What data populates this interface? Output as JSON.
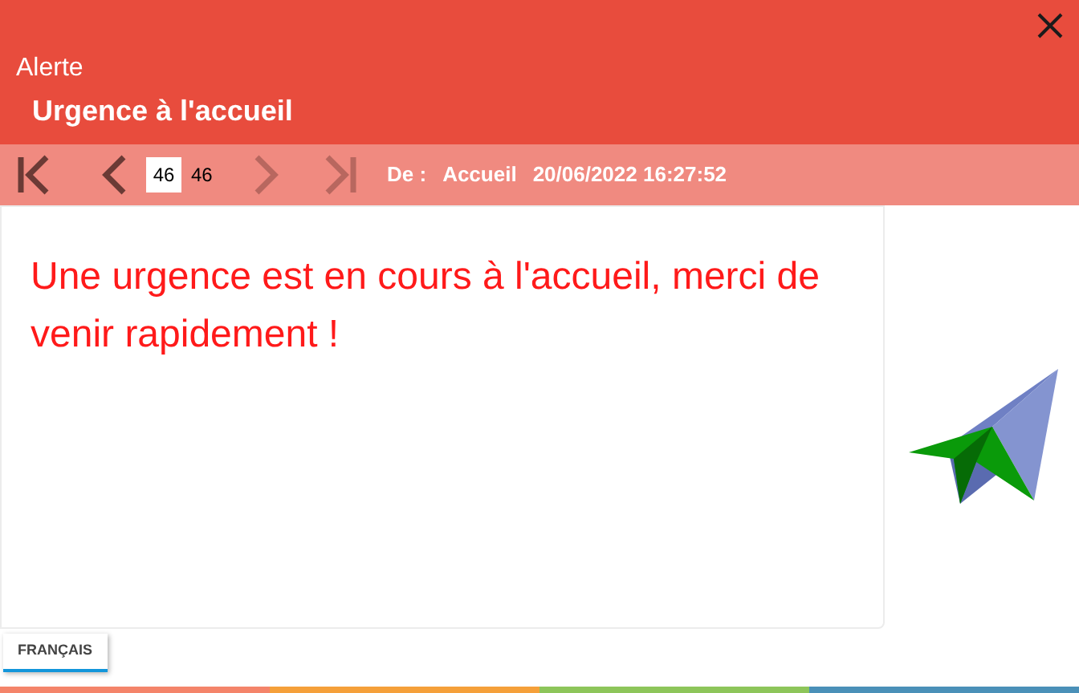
{
  "header": {
    "caption": "Alerte",
    "title": "Urgence à l'accueil"
  },
  "navigation": {
    "buttons": [
      {
        "kind": "first",
        "disabled": false
      },
      {
        "kind": "previous",
        "disabled": false
      },
      {
        "kind": "next",
        "disabled": true
      },
      {
        "kind": "last",
        "disabled": true
      }
    ],
    "page": "46",
    "total": "46"
  },
  "sender": {
    "label": "De :",
    "name": "Accueil",
    "datetime": "20/06/2022 16:27:52"
  },
  "message": "Une urgence est en cours à l'accueil, merci de venir rapidement !",
  "languages": [
    {
      "label": "FRANÇAIS",
      "selected": true
    }
  ],
  "footer_bar": [
    {
      "color": "#f4846a"
    },
    {
      "color": "#f5a03a"
    },
    {
      "color": "#8dc55a"
    },
    {
      "color": "#4a90b8"
    }
  ]
}
